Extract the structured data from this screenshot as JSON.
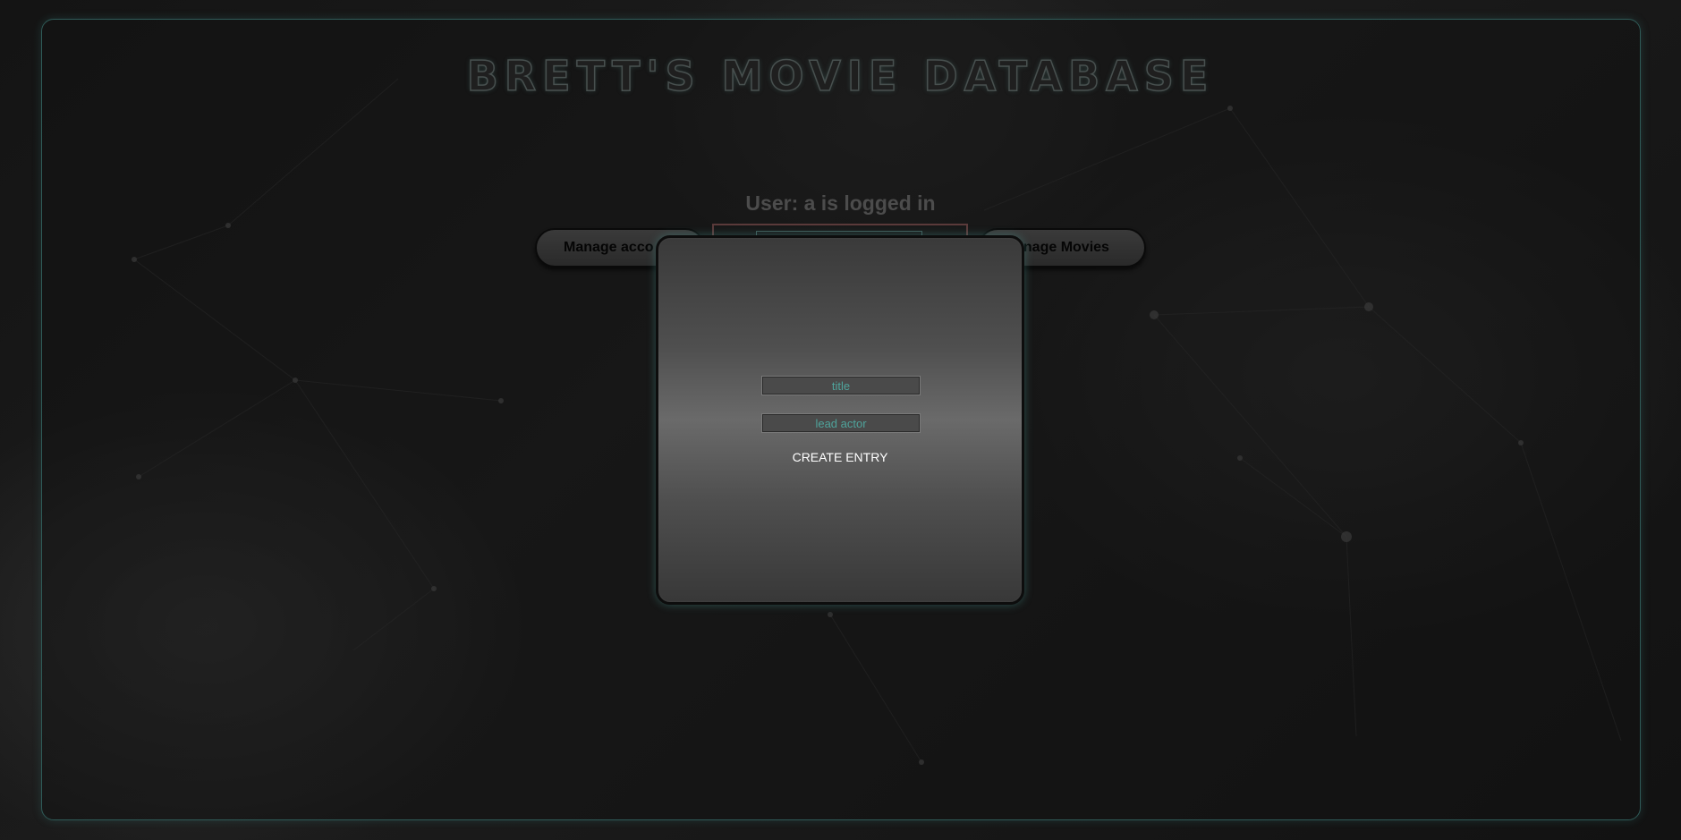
{
  "app": {
    "title": "BRETT'S MOVIE DATABASE"
  },
  "header": {
    "user_status": "User: a is logged in"
  },
  "nav": {
    "manage_account_label": "Manage acco",
    "manage_movies_label": "anage Movies"
  },
  "modal": {
    "title_placeholder": "title",
    "lead_actor_placeholder": "lead actor",
    "create_label": "CREATE ENTRY"
  },
  "colors": {
    "accent": "#4fa39b",
    "frame_border": "#2f5a57",
    "background": "#141414"
  }
}
